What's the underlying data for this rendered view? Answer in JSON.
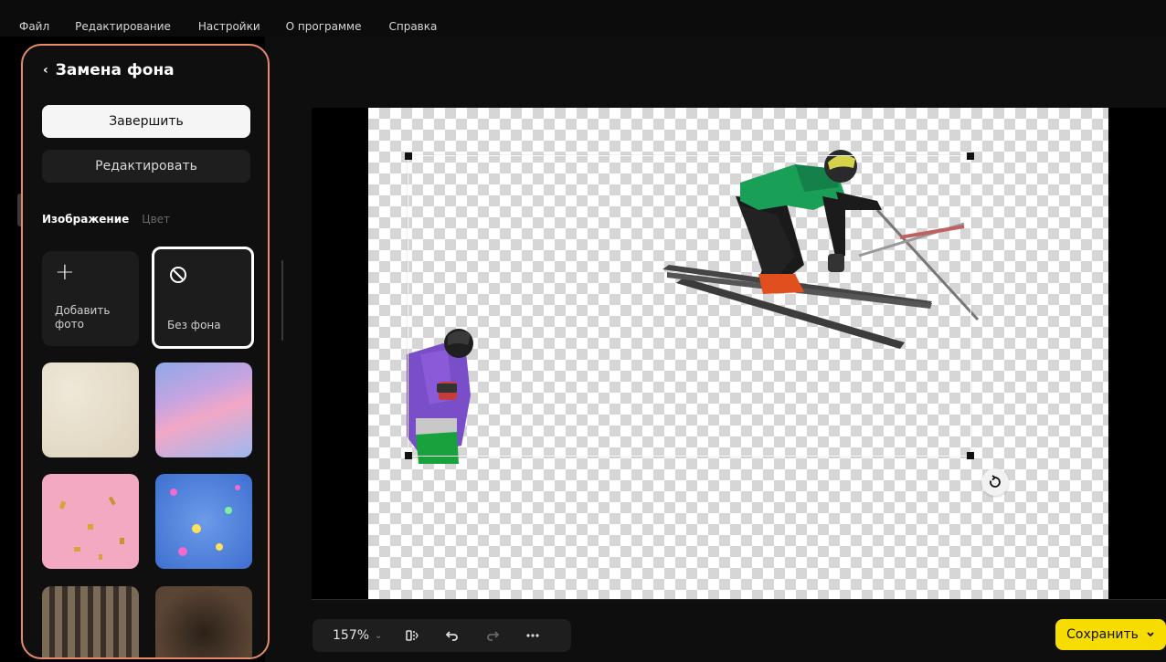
{
  "menu": {
    "items": [
      "Файл",
      "Редактирование",
      "Настройки",
      "О программе",
      "Справка"
    ]
  },
  "panel": {
    "title": "Замена фона",
    "finish_label": "Завершить",
    "edit_label": "Редактировать",
    "tabs": [
      {
        "label": "Изображение",
        "active": true
      },
      {
        "label": "Цвет",
        "active": false
      }
    ],
    "tiles": {
      "add_line1": "Добавить",
      "add_line2": "фото",
      "none_label": "Без фона"
    },
    "backgrounds": [
      "sand-texture",
      "pink-clouds-sky",
      "pink-gold-confetti",
      "blue-confetti",
      "building-facade",
      "wooden-corridor"
    ]
  },
  "toolbar": {
    "zoom": "157%",
    "icons": [
      "flip-icon",
      "undo-icon",
      "redo-icon",
      "more-icon"
    ]
  },
  "save": {
    "label": "Сохранить"
  },
  "colors": {
    "accent_yellow": "#f7dc00",
    "panel_border": "#e8896a",
    "panel_bg": "#0f0f0f"
  }
}
